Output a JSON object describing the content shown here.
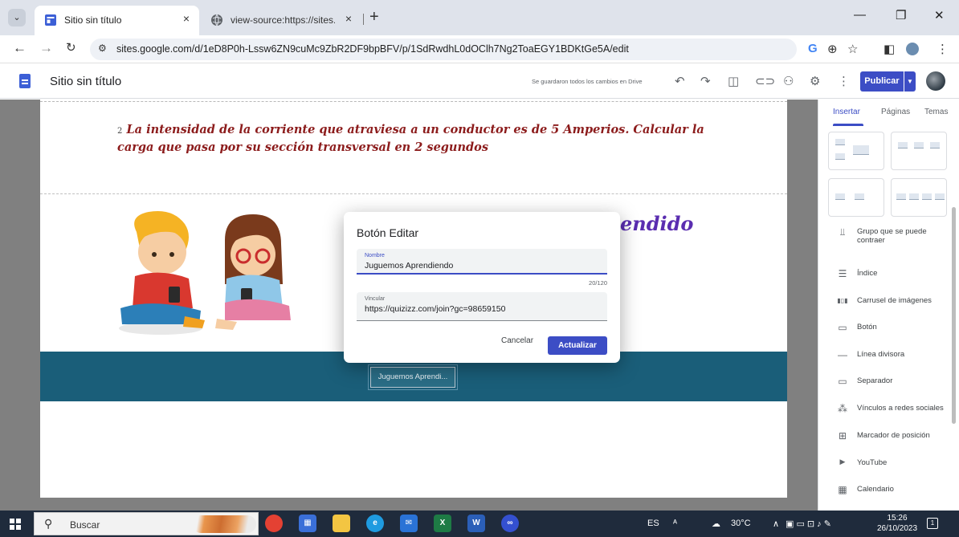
{
  "browser": {
    "tabs": [
      {
        "title": "Sitio sin título",
        "close": "×"
      },
      {
        "title": "view-source:https://sites.goog",
        "close": "×"
      }
    ],
    "new_tab": "+",
    "address": "sites.google.com/d/1eD8P0h-Lssw6ZN9cuMc9ZbR2DF9bpBFV/p/1SdRwdhL0dOClh7Ng2ToaEGY1BDKtGe5A/edit"
  },
  "sites_header": {
    "title": "Sitio sin título",
    "saved_status": "Se guardaron todos los cambios en Drive",
    "publish_label": "Publicar"
  },
  "page": {
    "question_number": "2",
    "question_text": "La intensidad de la corriente que atraviesa a un conductor es de 5 Amperios. Calcular la carga que pasa por su sección transversal en 2 segundos",
    "banner_text": "endido",
    "button_label": "Juguemos Aprendi..."
  },
  "panel": {
    "tabs": [
      "Insertar",
      "Páginas",
      "Temas"
    ],
    "items": [
      {
        "icon": "collapsible-group-icon",
        "glyph": "⫫",
        "label": "Grupo que se puede contraer"
      },
      {
        "icon": "index-icon",
        "glyph": "☰",
        "label": "Índice"
      },
      {
        "icon": "carousel-icon",
        "glyph": "▮▯▮",
        "label": "Carrusel de imágenes"
      },
      {
        "icon": "button-icon",
        "glyph": "▭",
        "label": "Botón"
      },
      {
        "icon": "divider-icon",
        "glyph": "—",
        "label": "Línea divisora"
      },
      {
        "icon": "spacer-icon",
        "glyph": "▭",
        "label": "Separador"
      },
      {
        "icon": "social-links-icon",
        "glyph": "⁂",
        "label": "Vínculos a redes sociales"
      },
      {
        "icon": "placeholder-icon",
        "glyph": "⊞",
        "label": "Marcador de posición"
      },
      {
        "icon": "youtube-icon",
        "glyph": "▶",
        "label": "YouTube"
      },
      {
        "icon": "calendar-icon",
        "glyph": "▦",
        "label": "Calendario"
      }
    ]
  },
  "dialog": {
    "title": "Botón Editar",
    "name_label": "Nombre",
    "name_value": "Juguemos Aprendiendo",
    "counter": "20/120",
    "link_label": "Vincular",
    "link_value": "https://quizizz.com/join?gc=98659150",
    "cancel_label": "Cancelar",
    "update_label": "Actualizar"
  },
  "taskbar": {
    "search_text": "Buscar",
    "language": "ES",
    "weather": "30°C",
    "time": "15:26",
    "date": "26/10/2023",
    "notifications": "1"
  },
  "colors": {
    "accent": "#3c4dc5",
    "banner_strip": "#1a5e79",
    "question_text": "#8c1c1c"
  }
}
